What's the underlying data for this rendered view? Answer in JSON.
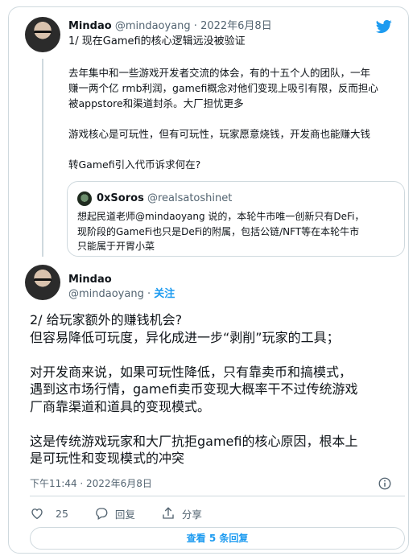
{
  "tweet1": {
    "name": "Mindao",
    "handle": "@mindaoyang",
    "separator": "·",
    "date": "2022年6月8日",
    "title": "1/ 现在Gamefi的核心逻辑远没被验证",
    "paragraphs": [
      "去年集中和一些游戏开发者交流的体会，有的十五个人的团队，一年\n赚一两个亿 rmb利润，gamefi概念对他们变现上吸引有限，反而担心\n被appstore和渠道封杀。大厂担忧更多",
      "游戏核心是可玩性，但有可玩性，玩家愿意烧钱，开发商也能赚大钱",
      "转Gamefi引入代币诉求何在?"
    ],
    "quote": {
      "name": "0xSoros",
      "handle": "@realsatoshinet",
      "text": "想起民道老师@mindaoyang 说的，本轮牛市唯一创新只有DeFi，\n现阶段的GameFi也只是DeFi的附属，包括公链/NFT等在本轮牛市\n只能属于开胃小菜"
    }
  },
  "tweet2": {
    "name": "Mindao",
    "handle": "@mindaoyang",
    "separator": "·",
    "follow_label": "关注",
    "paragraphs": [
      "2/ 给玩家额外的赚钱机会?\n但容易降低可玩度，异化成进一步“剥削”玩家的工具；",
      "对开发商来说，如果可玩性降低，只有靠卖币和搞模式，\n遇到这市场行情，gamefi卖币变现大概率干不过传统游戏\n厂商靠渠道和道具的变现模式。",
      "这是传统游戏玩家和大厂抗拒gamefi的核心原因，根本上\n是可玩性和变现模式的冲突"
    ],
    "timestamp": "下午11:44 · 2022年6月8日",
    "actions": {
      "likes": "25",
      "reply_label": "回复",
      "share_label": "分享"
    },
    "view_replies_label": "查看 5 条回复"
  },
  "icons": {
    "brand": "twitter-bird-icon",
    "like": "heart-icon",
    "reply": "speech-bubble-icon",
    "share": "share-arrow-icon",
    "info": "info-icon"
  },
  "colors": {
    "accent": "#1d9bf0",
    "text": "#0f1419",
    "muted": "#536471",
    "border": "#cfd9de"
  }
}
